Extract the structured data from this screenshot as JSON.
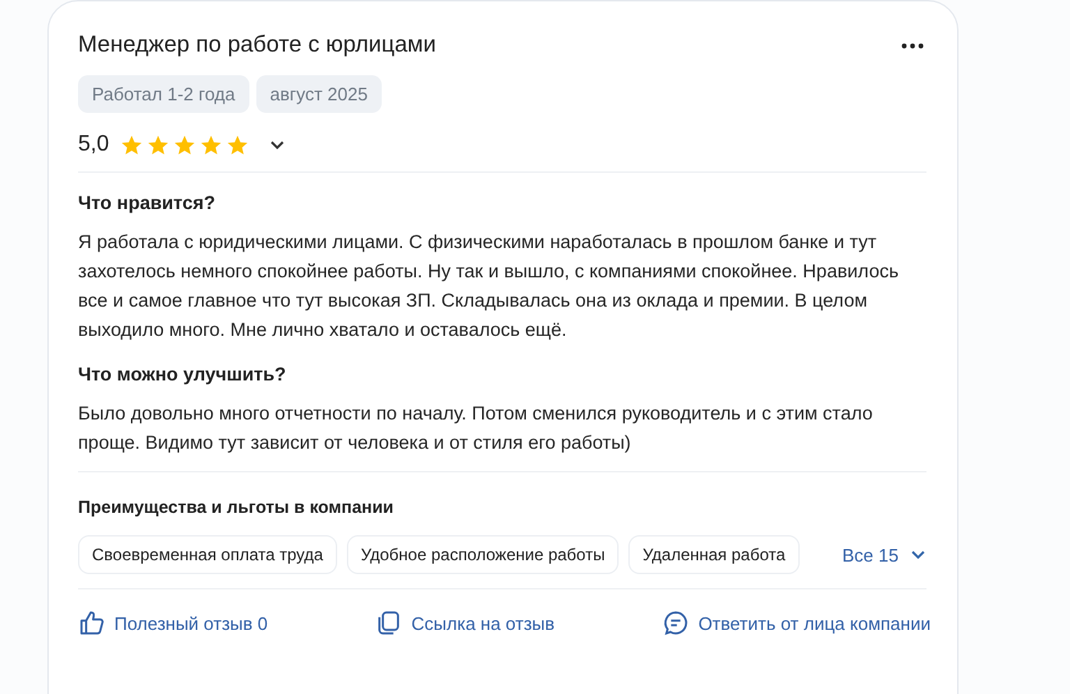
{
  "review": {
    "title": "Менеджер по работе с юрлицами",
    "tags": [
      "Работал 1-2 года",
      "август 2025"
    ],
    "rating": "5,0",
    "stars": 5,
    "sections": [
      {
        "heading": "Что нравится?",
        "text": "Я работала с юридическими лицами. С физическими наработалась в прошлом банке и тут захотелось немного спокойнее работы. Ну так и вышло, с компаниями спокойнее. Нравилось все и самое главное что тут высокая ЗП. Складывалась она из оклада и премии. В целом выходило много. Мне лично хватало и оставалось ещё."
      },
      {
        "heading": "Что можно улучшить?",
        "text": "Было довольно много отчетности по началу. Потом сменился руководитель и с этим стало проще. Видимо тут зависит от человека и от стиля его работы)"
      }
    ],
    "benefits": {
      "heading": "Преимущества и льготы в компании",
      "items": [
        "Своевременная оплата труда",
        "Удобное расположение работы",
        "Удаленная работа"
      ],
      "more": "Все 15"
    },
    "actions": [
      {
        "kind": "like",
        "label": "Полезный отзыв 0"
      },
      {
        "kind": "link",
        "label": "Ссылка на отзыв"
      },
      {
        "kind": "reply",
        "label": "Ответить от лица компании"
      }
    ]
  }
}
